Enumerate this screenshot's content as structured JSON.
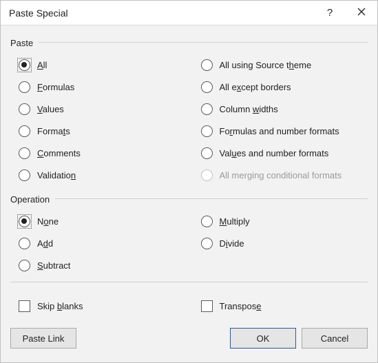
{
  "title": "Paste Special",
  "help_tooltip": "?",
  "groups": {
    "paste": {
      "label": "Paste",
      "left": [
        {
          "html": "<span class='ul'>A</span>ll",
          "selected": true
        },
        {
          "html": "<span class='ul'>F</span>ormulas"
        },
        {
          "html": "<span class='ul'>V</span>alues"
        },
        {
          "html": "Forma<span class='ul'>t</span>s"
        },
        {
          "html": "<span class='ul'>C</span>omments"
        },
        {
          "html": "Validatio<span class='ul'>n</span>"
        }
      ],
      "right": [
        {
          "html": "All using Source t<span class='ul'>h</span>eme"
        },
        {
          "html": "All e<span class='ul'>x</span>cept borders"
        },
        {
          "html": "Column <span class='ul'>w</span>idths"
        },
        {
          "html": "Fo<span class='ul'>r</span>mulas and number formats"
        },
        {
          "html": "Val<span class='ul'>u</span>es and number formats"
        },
        {
          "html": "All merging conditional formats",
          "disabled": true
        }
      ]
    },
    "operation": {
      "label": "Operation",
      "left": [
        {
          "html": "N<span class='ul'>o</span>ne",
          "selected": true
        },
        {
          "html": "A<span class='ul'>d</span>d"
        },
        {
          "html": "<span class='ul'>S</span>ubtract"
        }
      ],
      "right": [
        {
          "html": "<span class='ul'>M</span>ultiply"
        },
        {
          "html": "D<span class='ul'>i</span>vide"
        }
      ]
    }
  },
  "checkboxes": {
    "skip_blanks": "Skip <span class='ul'>b</span>lanks",
    "transpose": "Transpos<span class='ul'>e</span>"
  },
  "buttons": {
    "paste_link": "Paste <span class='ul'>L</span>ink",
    "ok": "OK",
    "cancel": "Cancel"
  }
}
